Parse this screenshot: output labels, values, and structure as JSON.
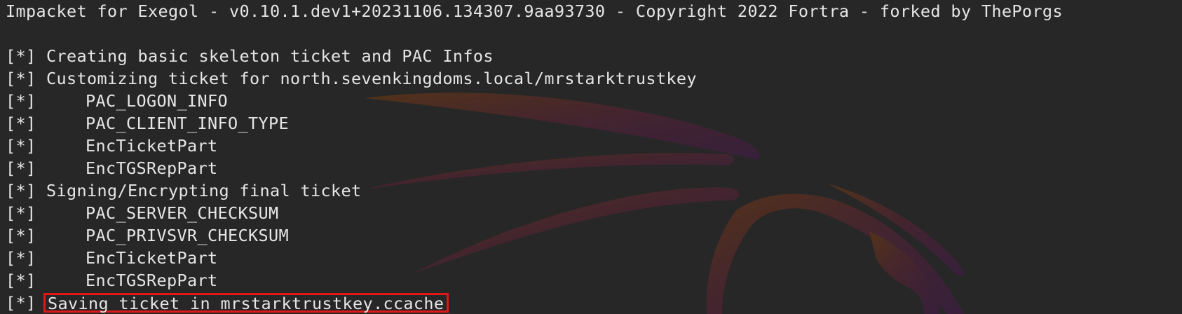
{
  "terminal": {
    "banner": "Impacket for Exegol - v0.10.1.dev1+20231106.134307.9aa93730 - Copyright 2022 Fortra - forked by ThePorgs",
    "prefix": "[*]",
    "lines": [
      {
        "text": "Creating basic skeleton ticket and PAC Infos",
        "indent": false,
        "highlight": false
      },
      {
        "text": "Customizing ticket for north.sevenkingdoms.local/mrstarktrustkey",
        "indent": false,
        "highlight": false
      },
      {
        "text": "PAC_LOGON_INFO",
        "indent": true,
        "highlight": false
      },
      {
        "text": "PAC_CLIENT_INFO_TYPE",
        "indent": true,
        "highlight": false
      },
      {
        "text": "EncTicketPart",
        "indent": true,
        "highlight": false
      },
      {
        "text": "EncTGSRepPart",
        "indent": true,
        "highlight": false
      },
      {
        "text": "Signing/Encrypting final ticket",
        "indent": false,
        "highlight": false
      },
      {
        "text": "PAC_SERVER_CHECKSUM",
        "indent": true,
        "highlight": false
      },
      {
        "text": "PAC_PRIVSVR_CHECKSUM",
        "indent": true,
        "highlight": false
      },
      {
        "text": "EncTicketPart",
        "indent": true,
        "highlight": false
      },
      {
        "text": "EncTGSRepPart",
        "indent": true,
        "highlight": false
      },
      {
        "text": "Saving ticket in mrstarktrustkey.ccache",
        "indent": false,
        "highlight": true
      }
    ],
    "colors": {
      "background": "#272727",
      "text": "#e6e6e6",
      "highlight_border": "#e01818",
      "dragon_warm": "#5a3518",
      "dragon_cool": "#3a1f3f"
    }
  }
}
